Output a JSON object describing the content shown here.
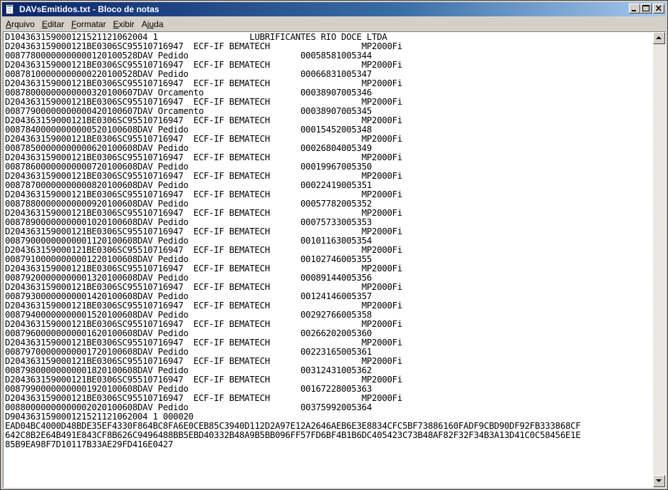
{
  "window": {
    "title": "DAVsEmitidos.txt - Bloco de notas",
    "buttons": {
      "minimize": "_",
      "maximize": "□",
      "close": "×"
    }
  },
  "menu": [
    {
      "underline": "A",
      "rest": "rquivo"
    },
    {
      "underline": "E",
      "rest": "ditar"
    },
    {
      "underline": "F",
      "rest": "ormatar"
    },
    {
      "underline": "E",
      "rest": "xibir"
    },
    {
      "pre": "Aj",
      "underline": "u",
      "rest": "da"
    }
  ],
  "document": {
    "lines": [
      "D104363159000121521121062004 1                  LUBRIFICANTES RIO DOCE LTDA",
      "D204363159000121BE0306SC95510716947  ECF-IF BEMATECH                  MP2000Fi",
      "00877800000000000120100528DAV Pedido                      00058581005344",
      "D204363159000121BE0306SC95510716947  ECF-IF BEMATECH                  MP2000Fi",
      "00878100000000000220100528DAV Pedido                      00066831005347",
      "D204363159000121BE0306SC95510716947  ECF-IF BEMATECH                  MP2000Fi",
      "00878000000000000320100607DAV Orcamento                   00038907005346",
      "D204363159000121BE0306SC95510716947  ECF-IF BEMATECH                  MP2000Fi",
      "00877900000000000420100607DAV Orcamento                   00038907005345",
      "D204363159000121BE0306SC95510716947  ECF-IF BEMATECH                  MP2000Fi",
      "00878400000000000520100608DAV Pedido                      00015452005348",
      "D204363159000121BE0306SC95510716947  ECF-IF BEMATECH                  MP2000Fi",
      "00878500000000000620100608DAV Pedido                      00026804005349",
      "D204363159000121BE0306SC95510716947  ECF-IF BEMATECH                  MP2000Fi",
      "00878600000000000720100608DAV Pedido                      00019967005350",
      "D204363159000121BE0306SC95510716947  ECF-IF BEMATECH                  MP2000Fi",
      "00878700000000000820100608DAV Pedido                      00022419005351",
      "D204363159000121BE0306SC95510716947  ECF-IF BEMATECH                  MP2000Fi",
      "00878800000000000920100608DAV Pedido                      00057782005352",
      "D204363159000121BE0306SC95510716947  ECF-IF BEMATECH                  MP2000Fi",
      "00878900000000001020100608DAV Pedido                      00075733005353",
      "D204363159000121BE0306SC95510716947  ECF-IF BEMATECH                  MP2000Fi",
      "00879000000000001120100608DAV Pedido                      00101163005354",
      "D204363159000121BE0306SC95510716947  ECF-IF BEMATECH                  MP2000Fi",
      "00879100000000001220100608DAV Pedido                      00102746005355",
      "D204363159000121BE0306SC95510716947  ECF-IF BEMATECH                  MP2000Fi",
      "00879200000000001320100608DAV Pedido                      00089144005356",
      "D204363159000121BE0306SC95510716947  ECF-IF BEMATECH                  MP2000Fi",
      "00879300000000001420100608DAV Pedido                      00124146005357",
      "D204363159000121BE0306SC95510716947  ECF-IF BEMATECH                  MP2000Fi",
      "00879400000000001520100608DAV Pedido                      00292766005358",
      "D204363159000121BE0306SC95510716947  ECF-IF BEMATECH                  MP2000Fi",
      "00879600000000001620100608DAV Pedido                      00266202005360",
      "D204363159000121BE0306SC95510716947  ECF-IF BEMATECH                  MP2000Fi",
      "00879700000000001720100608DAV Pedido                      00223165005361",
      "D204363159000121BE0306SC95510716947  ECF-IF BEMATECH                  MP2000Fi",
      "00879800000000001820100608DAV Pedido                      00312431005362",
      "D204363159000121BE0306SC95510716947  ECF-IF BEMATECH                  MP2000Fi",
      "00879900000000001920100608DAV Pedido                      00167228005363",
      "D204363159000121BE0306SC95510716947  ECF-IF BEMATECH                  MP2000Fi",
      "00880000000000002020100608DAV Pedido                      00375992005364",
      "D904363159000121521121062004 1 000020",
      "EAD04BC4000D48BDE35EF4330F864BC8FA6E0CEB85C3940D112D2A97E12A2646AEB6E3E8834CFC5BF73886160FADF9CBD90DF92FB333868CF",
      "642C8B2E64B491E843CF8B626C9496488BB5EBD40332B48A9B5BB096FF57FD6BF4B1B6DC405423C73B48AF82F32F34B3A13D41C0C58456E1E",
      "85B9EA98F7D10117B33AE29FD416E0427"
    ]
  }
}
